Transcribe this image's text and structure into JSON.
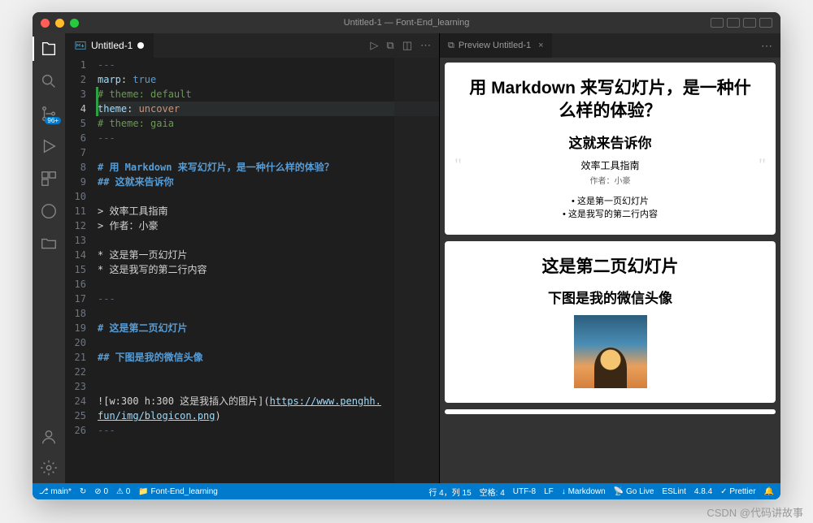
{
  "window": {
    "title": "Untitled-1 — Font-End_learning"
  },
  "editor_tab": {
    "label": "Untitled-1"
  },
  "preview_tab": {
    "label": "Preview Untitled-1"
  },
  "code": {
    "l1": "---",
    "l2_key": "marp",
    "l2_val": "true",
    "l3": "# theme: default",
    "l4_key": "theme",
    "l4_val": "uncover",
    "l5": "# theme: gaia",
    "l6": "---",
    "l8": "# 用 Markdown 来写幻灯片，是一种什么样的体验？",
    "l9": "## 这就来告诉你",
    "l11": "> 效率工具指南",
    "l12": "> 作者：小豪",
    "l14": "* 这是第一页幻灯片",
    "l15": "* 这是我写的第二行内容",
    "l17": "---",
    "l19": "# 这是第二页幻灯片",
    "l21": "## 下图是我的微信头像",
    "l24a": "![w:300 h:300 这是我插入的图片](",
    "l24b": "https://www.penghh.",
    "l25": "fun/img/blogicon.png",
    "l25b": ")",
    "l26": "---"
  },
  "slide1": {
    "title": "用 Markdown 来写幻灯片，是一种什么样的体验？",
    "subtitle": "这就来告诉你",
    "quote1": "效率工具指南",
    "quote2": "作者：小豪",
    "bullet1": "这是第一页幻灯片",
    "bullet2": "这是我写的第二行内容"
  },
  "slide2": {
    "title": "这是第二页幻灯片",
    "subtitle": "下图是我的微信头像"
  },
  "status": {
    "branch": "main*",
    "sync": "↻",
    "errors": "⊘ 0",
    "warnings": "⚠ 0",
    "folder": "Font-End_learning",
    "cursor": "行 4，列 15",
    "spaces": "空格: 4",
    "encoding": "UTF-8",
    "eol": "LF",
    "lang": "Markdown",
    "golive": "Go Live",
    "eslint": "ESLint",
    "version": "4.8.4",
    "prettier": "Prettier"
  },
  "badge": "96+",
  "watermark": "CSDN @代码讲故事"
}
